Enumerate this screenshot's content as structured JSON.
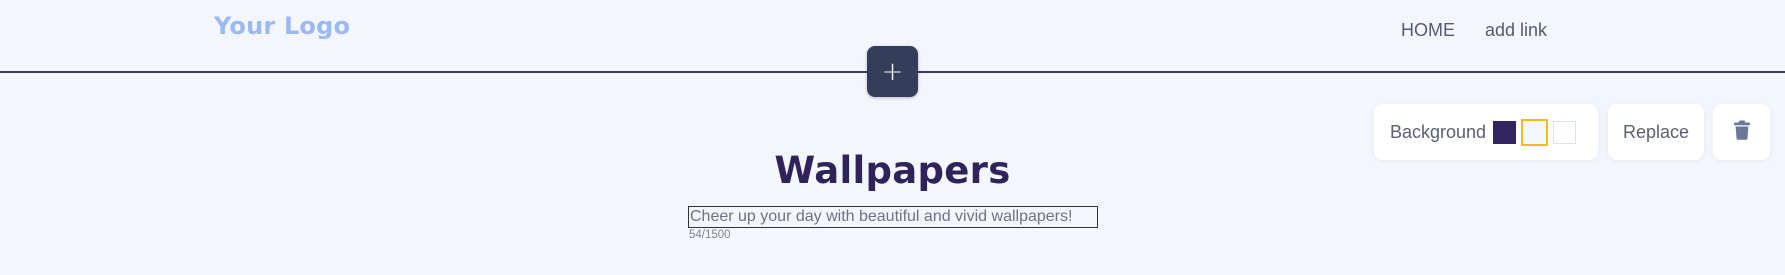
{
  "header": {
    "logo_text": "Your Logo",
    "nav": [
      {
        "label": "HOME"
      },
      {
        "label": "add link"
      }
    ]
  },
  "add_section_button": {
    "label": "+"
  },
  "toolbar": {
    "background_label": "Background",
    "swatches": [
      {
        "name": "dark",
        "color": "#332462"
      },
      {
        "name": "light",
        "color": "#f3f6fd",
        "selected": true,
        "border": "#f2bd1b"
      },
      {
        "name": "white",
        "color": "#ffffff"
      }
    ],
    "replace_label": "Replace",
    "delete_icon": "trash-icon"
  },
  "content": {
    "title": "Wallpapers",
    "subtitle": "Cheer up your day with beautiful and vivid wallpapers!",
    "char_count": "54/1500"
  },
  "colors": {
    "page_background": "#f3f6fd",
    "logo": "#9db9f3",
    "title": "#2f2359",
    "add_button": "#343d5a",
    "divider": "#3b4258"
  }
}
